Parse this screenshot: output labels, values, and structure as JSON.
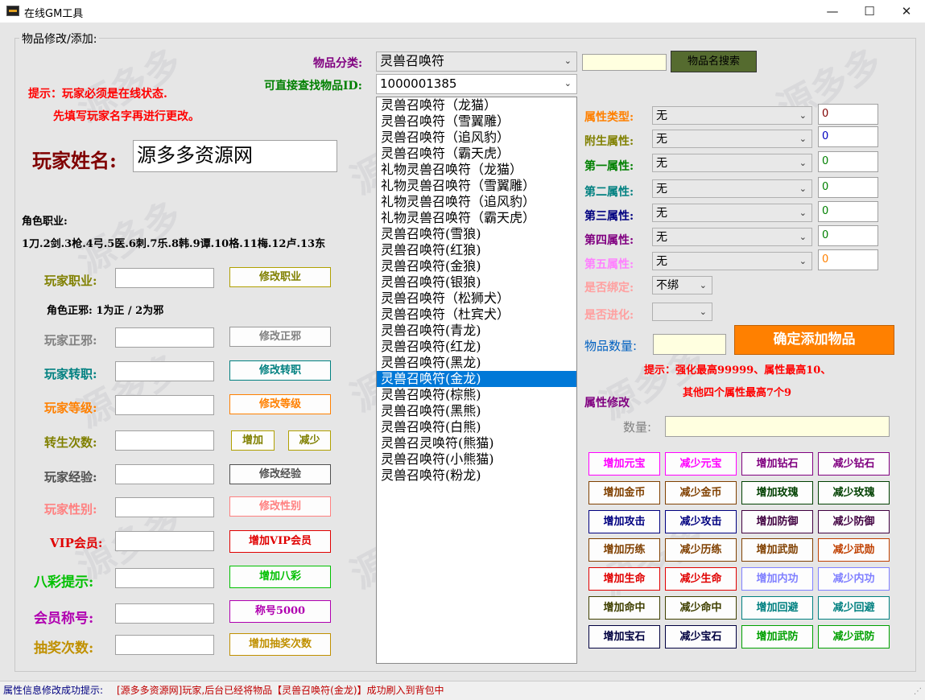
{
  "window": {
    "title": "在线GM工具",
    "min": "—",
    "max": "☐",
    "close": "✕"
  },
  "group_title": "物品修改/添加:",
  "hint": {
    "line1": "提示：玩家必须是在线状态.",
    "line2": "先填写玩家名字再进行更改。"
  },
  "player_name": {
    "label": "玩家姓名:",
    "value": "源多多资源网"
  },
  "job_info": {
    "title": "角色职业:",
    "list": "1刀.2剑.3枪.4弓.5医.6刺.7乐.8韩.9谭.10格.11梅.12卢.13东"
  },
  "align_info": "角色正邪: 1为正 / 2为邪",
  "rows": [
    {
      "label": "玩家职业:",
      "button": "修改职业",
      "color": "#808000"
    },
    {
      "label": "玩家正邪:",
      "button": "修改正邪",
      "color": "#808080"
    },
    {
      "label": "玩家转职:",
      "button": "修改转职",
      "color": "#008080"
    },
    {
      "label": "玩家等级:",
      "button": "修改等级",
      "color": "#ff8000"
    },
    {
      "label": "转生次数:",
      "button_add": "增加",
      "button_sub": "减少",
      "color": "#808000"
    },
    {
      "label": "玩家经验:",
      "button": "修改经验",
      "color": "#505050"
    },
    {
      "label": "玩家性别:",
      "button": "修改性别",
      "color": "#ff8080"
    },
    {
      "label": "VIP会员:",
      "button": "增加VIP会员",
      "color": "#e00000"
    },
    {
      "label": "八彩提示:",
      "button": "增加八彩",
      "color": "#00c000"
    },
    {
      "label": "会员称号:",
      "button": "称号5000",
      "color": "#b000b0"
    },
    {
      "label": "抽奖次数:",
      "button": "增加抽奖次数",
      "color": "#c09000"
    }
  ],
  "category": {
    "label": "物品分类:",
    "value": "灵兽召唤符"
  },
  "item_id": {
    "label": "可直接查找物品ID:",
    "value": "1000001385"
  },
  "search": {
    "value": "",
    "button": "物品名搜索"
  },
  "items": [
    "灵兽召唤符（龙猫）",
    "灵兽召唤符（雪翼雕）",
    "灵兽召唤符（追风豹）",
    "灵兽召唤符（霸天虎）",
    "礼物灵兽召唤符（龙猫）",
    "礼物灵兽召唤符（雪翼雕）",
    "礼物灵兽召唤符（追风豹）",
    "礼物灵兽召唤符（霸天虎）",
    "灵兽召唤符(雪狼)",
    "灵兽召唤符(红狼)",
    "灵兽召唤符(金狼)",
    "灵兽召唤符(银狼)",
    "灵兽召唤符（松狮犬）",
    "灵兽召唤符（杜宾犬）",
    "灵兽召唤符(青龙)",
    "灵兽召唤符(红龙)",
    "灵兽召唤符(黑龙)",
    "灵兽召唤符(金龙)",
    "灵兽召唤符(棕熊)",
    "灵兽召唤符(黑熊)",
    "灵兽召唤符(白熊)",
    "灵兽召灵唤符(熊猫)",
    "灵兽召唤符(小熊猫)",
    "灵兽召唤符(粉龙)"
  ],
  "selected_index": 17,
  "attrs": [
    {
      "label": "属性类型:",
      "value": "无",
      "num": "0",
      "color": "#ff8000",
      "numcolor": "#800000"
    },
    {
      "label": "附生属性:",
      "value": "无",
      "num": "0",
      "color": "#808000",
      "numcolor": "#0000c0"
    },
    {
      "label": "第一属性:",
      "value": "无",
      "num": "0",
      "color": "#008000",
      "numcolor": "#008000"
    },
    {
      "label": "第二属性:",
      "value": "无",
      "num": "0",
      "color": "#008080",
      "numcolor": "#008000"
    },
    {
      "label": "第三属性:",
      "value": "无",
      "num": "0",
      "color": "#000080",
      "numcolor": "#008000"
    },
    {
      "label": "第四属性:",
      "value": "无",
      "num": "0",
      "color": "#800080",
      "numcolor": "#008000"
    },
    {
      "label": "第五属性:",
      "value": "无",
      "num": "0",
      "color": "#ff80ff",
      "numcolor": "#ff8000"
    }
  ],
  "bind": {
    "label": "是否绑定:",
    "value": "不绑"
  },
  "evolve": {
    "label": "是否进化:",
    "value": ""
  },
  "quantity": {
    "label": "物品数量:",
    "value": ""
  },
  "add_button": "确定添加物品",
  "limit_hint": {
    "line1": "提示：强化最高99999、属性最高10、",
    "line2": "其他四个属性最高7个9"
  },
  "attr_modify": {
    "title": "属性修改",
    "qty_label": "数量:",
    "qty_value": ""
  },
  "grid_buttons": [
    [
      "增加元宝",
      "减少元宝",
      "增加钻石",
      "减少钻石"
    ],
    [
      "增加金币",
      "减少金币",
      "增加玫瑰",
      "减少玫瑰"
    ],
    [
      "增加攻击",
      "减少攻击",
      "增加防御",
      "减少防御"
    ],
    [
      "增加历练",
      "减少历练",
      "增加武勋",
      "减少武勋"
    ],
    [
      "增加生命",
      "减少生命",
      "增加内功",
      "减少内功"
    ],
    [
      "增加命中",
      "减少命中",
      "增加回避",
      "减少回避"
    ],
    [
      "增加宝石",
      "减少宝石",
      "增加武防",
      "减少武防"
    ]
  ],
  "grid_colors": [
    [
      "#ff00ff",
      "#ff00ff",
      "#800080",
      "#800080"
    ],
    [
      "#804000",
      "#804000",
      "#004000",
      "#004000"
    ],
    [
      "#000080",
      "#000080",
      "#400040",
      "#400040"
    ],
    [
      "#804000",
      "#804000",
      "#804000",
      "#c04000"
    ],
    [
      "#e00000",
      "#e00000",
      "#8080ff",
      "#8080ff"
    ],
    [
      "#404000",
      "#404000",
      "#008080",
      "#008080"
    ],
    [
      "#000040",
      "#000040",
      "#00a000",
      "#00a000"
    ]
  ],
  "status": {
    "label": "属性信息修改成功提示:",
    "message": "[源多多资源网]玩家,后台已经将物品【灵兽召唤符(金龙)】成功刷入到背包中"
  }
}
